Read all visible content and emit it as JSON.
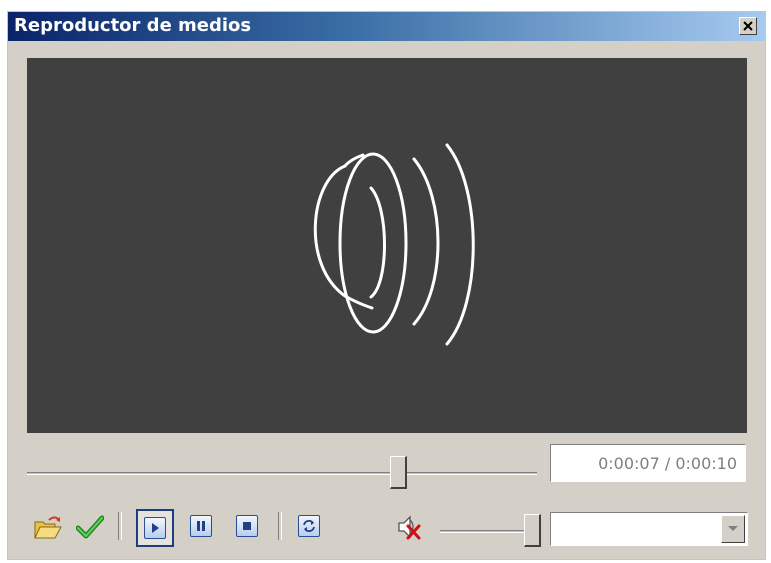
{
  "window": {
    "title": "Reproductor de medios"
  },
  "player": {
    "time_display": "0:00:07 / 0:00:10",
    "seek_position": 0.7,
    "volume_level": 1.0
  },
  "icons": [
    "close-icon",
    "speaker-icon",
    "open-folder-icon",
    "checkmark-icon",
    "play-icon",
    "pause-icon",
    "stop-icon",
    "loop-icon",
    "mute-icon",
    "dropdown-arrow-icon"
  ],
  "device_select": {
    "selected": ""
  }
}
